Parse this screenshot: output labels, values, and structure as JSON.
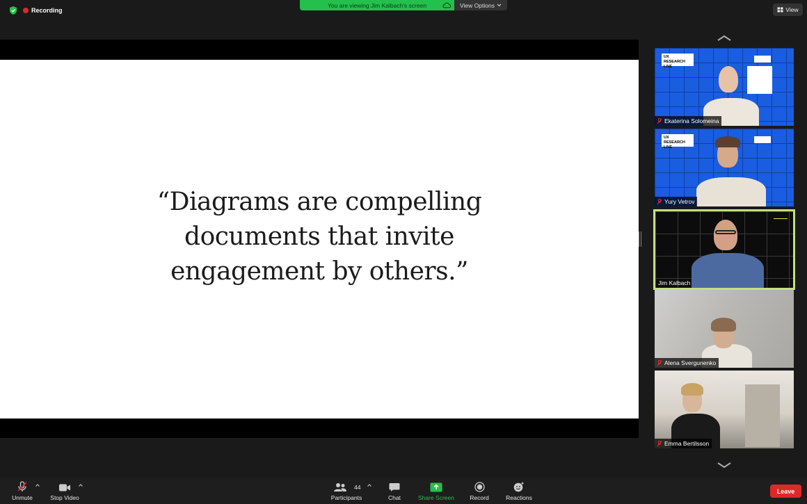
{
  "topbar": {
    "recording_label": "Recording",
    "banner_text": "You are viewing Jim Kalbach's screen",
    "view_options_label": "View Options",
    "view_label": "View"
  },
  "slide": {
    "quote_line1": "“Diagrams are compelling",
    "quote_line2": "documents that invite",
    "quote_line3": "engagement by others.”"
  },
  "participants": [
    {
      "name": "Ekaterina Solomeina",
      "badge": "UX RESEARCH LIVE"
    },
    {
      "name": "Yury Vetrov",
      "badge": "UX RESEARCH LIVE"
    },
    {
      "name": "Jim Kalbach",
      "badge": ""
    },
    {
      "name": "Alena Svergunenko",
      "badge": ""
    },
    {
      "name": "Emma Bertilsson",
      "badge": ""
    }
  ],
  "toolbar": {
    "unmute": "Unmute",
    "stop_video": "Stop Video",
    "participants": "Participants",
    "participants_count": "44",
    "chat": "Chat",
    "share_screen": "Share Screen",
    "record": "Record",
    "reactions": "Reactions",
    "leave": "Leave"
  },
  "colors": {
    "share_green": "#23c14b",
    "leave_red": "#e02828",
    "active_speaker": "#c4e07a"
  }
}
